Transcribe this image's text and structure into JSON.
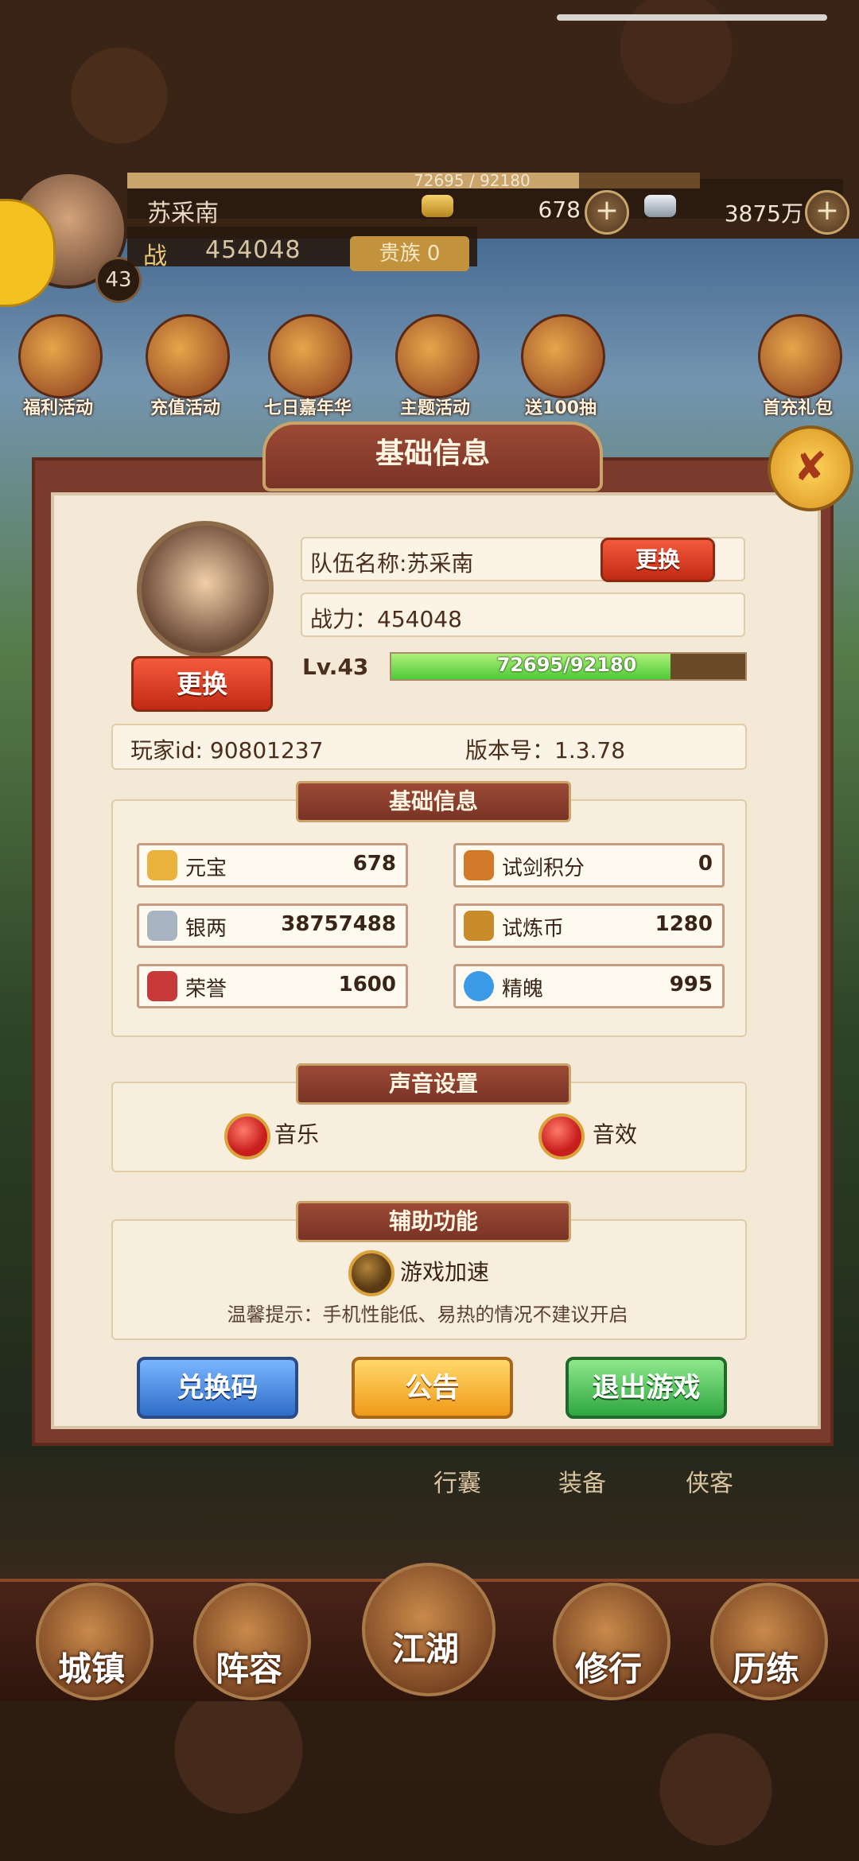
{
  "hud": {
    "player_name": "苏采南",
    "exp_text": "72695 / 92180",
    "exp_fraction": 0.789,
    "level": "43",
    "gold": "678",
    "silver": "3875万",
    "plus": "+",
    "power_icon": "战",
    "power": "454048",
    "noble": "贵族 0"
  },
  "activities": [
    {
      "label": "福利活动",
      "icon": "gift-icon"
    },
    {
      "label": "充值活动",
      "icon": "recharge-icon"
    },
    {
      "label": "七日嘉年华",
      "icon": "seven-day-icon"
    },
    {
      "label": "主题活动",
      "icon": "theme-icon"
    },
    {
      "label": "送100抽",
      "icon": "draw-icon"
    },
    {
      "label": "首充礼包",
      "icon": "first-recharge-icon"
    }
  ],
  "dialog": {
    "title": "基础信息",
    "close_icon": "✘",
    "change_avatar": "更换",
    "team_name": "队伍名称:苏采南",
    "change_name": "更换",
    "power": "战力：454048",
    "level": "Lv.43",
    "exp_text": "72695/92180",
    "exp_fraction": 0.789,
    "player_id": "玩家id: 90801237",
    "version": "版本号：1.3.78"
  },
  "resources_section": {
    "title": "基础信息",
    "items": [
      {
        "name": "元宝",
        "value": "678",
        "icon": "gold-ingot-icon",
        "color": "#e9b23a"
      },
      {
        "name": "试剑积分",
        "value": "0",
        "icon": "sword-points-icon",
        "color": "#d2792a"
      },
      {
        "name": "银两",
        "value": "38757488",
        "icon": "silver-ingot-icon",
        "color": "#a9b4c2"
      },
      {
        "name": "试炼币",
        "value": "1280",
        "icon": "trial-coin-icon",
        "color": "#c98a2a"
      },
      {
        "name": "荣誉",
        "value": "1600",
        "icon": "honor-icon",
        "color": "#c83a3a"
      },
      {
        "name": "精魄",
        "value": "995",
        "icon": "soul-icon",
        "color": "#3a9ae8"
      }
    ]
  },
  "sound_section": {
    "title": "声音设置",
    "music": "音乐",
    "effects": "音效"
  },
  "assist_section": {
    "title": "辅助功能",
    "speed": "游戏加速",
    "tip": "温馨提示：手机性能低、易热的情况不建议开启"
  },
  "buttons": {
    "redeem": "兑换码",
    "notice": "公告",
    "exit": "退出游戏"
  },
  "sub_nav": [
    "行囊",
    "装备",
    "侠客"
  ],
  "bottom_nav": [
    "城镇",
    "阵容",
    "江湖",
    "修行",
    "历练"
  ]
}
